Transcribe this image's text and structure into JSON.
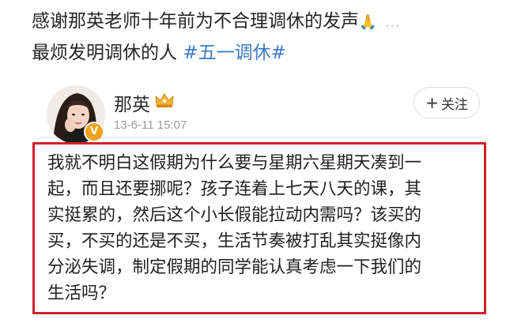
{
  "caption": {
    "line1_text": "感谢那英老师十年前为不合理调休的发声",
    "line1_emoji": "🙏",
    "line1_trailing": "…",
    "line2_text": "最烦发明调休的人 ",
    "hashtag": "#五一调休#"
  },
  "post": {
    "username": "那英",
    "timestamp": "13-6-11 15:07",
    "follow_label": "关注",
    "follow_plus": "+",
    "verified_mark": "V",
    "crown_icon": "crown-badge-icon",
    "content_lines": [
      "我就不明白这假期为什么要与星期六星期天凑到一",
      "起，而且还要挪呢？孩子连着上七天八天的课，其",
      "实挺累的，然后这个小长假能拉动内需吗？该买的",
      "买，不买的还是不买，生活节奏被打乱其实挺像内",
      "分泌失调，制定假期的同学能认真考虑一下我们的",
      "生活吗？"
    ]
  },
  "colors": {
    "highlight_border": "#d1212a",
    "hashtag": "#3e7bc2",
    "verified": "#f2a21c",
    "timestamp": "#9a9a9a"
  }
}
